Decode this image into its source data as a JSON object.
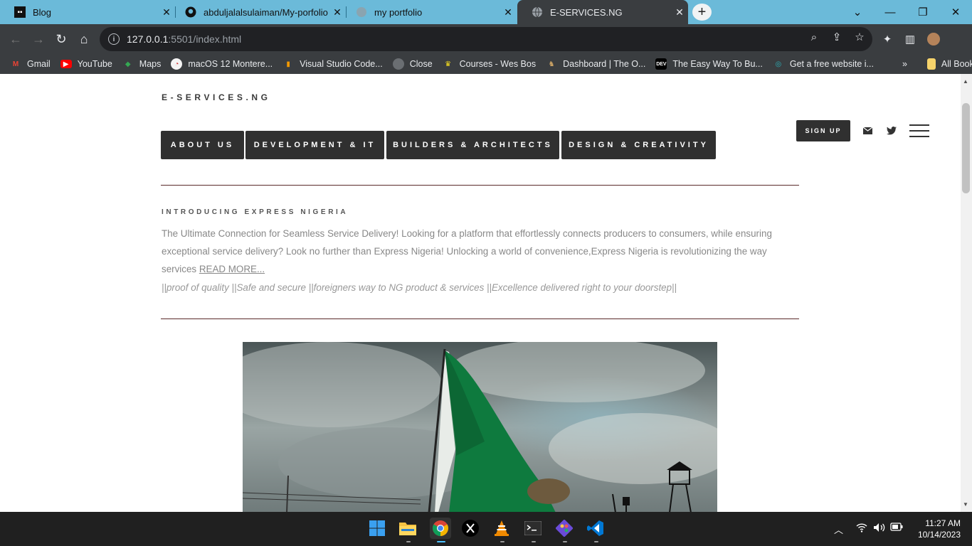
{
  "browser": {
    "tabs": [
      {
        "title": "Blog",
        "icon": "blog-favicon",
        "active": false
      },
      {
        "title": "abduljalalsulaiman/My-porfolio",
        "icon": "github-icon",
        "active": false
      },
      {
        "title": "my portfolio",
        "icon": "globe-icon",
        "active": false
      },
      {
        "title": "E-SERVICES.NG",
        "icon": "globe-icon",
        "active": true
      }
    ],
    "url_host": "127.0.0.1",
    "url_rest": ":5501/index.html",
    "bookmarks": [
      {
        "label": "Gmail",
        "icon": "gmail-icon",
        "color": "#ea4335"
      },
      {
        "label": "YouTube",
        "icon": "youtube-icon",
        "color": "#ff0000"
      },
      {
        "label": "Maps",
        "icon": "maps-icon",
        "color": "#34a853"
      },
      {
        "label": "macOS 12 Montere...",
        "icon": "bookmark-site-icon",
        "color": "#e8eaed"
      },
      {
        "label": "Visual Studio Code...",
        "icon": "bookmark-flag-icon",
        "color": "#f29900"
      },
      {
        "label": "Close",
        "icon": "globe-icon",
        "color": "#9aa0a6"
      },
      {
        "label": "Courses - Wes Bos",
        "icon": "crown-icon",
        "color": "#f7df1e"
      },
      {
        "label": "Dashboard | The O...",
        "icon": "odin-icon",
        "color": "#c8a063"
      },
      {
        "label": "The Easy Way To Bu...",
        "icon": "dev-icon",
        "color": "#000000"
      },
      {
        "label": "Get a free website i...",
        "icon": "website-builder-icon",
        "color": "#2bb0b8"
      }
    ],
    "all_bookmarks": "All Bookmarks"
  },
  "site": {
    "brand": "E-SERVICES.NG",
    "menu": [
      "ABOUT US",
      "DEVELOPMENT & IT",
      "BUILDERS & ARCHITECTS",
      "DESIGN & CREATIVITY"
    ],
    "signup": "SIGN UP",
    "intro_heading": "INTRODUCING EXPRESS NIGERIA",
    "intro_text": "The Ultimate Connection for Seamless Service Delivery! Looking for a platform that effortlessly connects producers to consumers, while ensuring exceptional service delivery? Look no further than Express Nigeria! Unlocking a world of convenience,Express Nigeria is revolutionizing the way services ",
    "read_more": "READ MORE...",
    "tagline": "||proof of quality ||Safe and secure ||foreigners way to NG product & services ||Excellence delivered right to your doorstep||"
  },
  "taskbar": {
    "time": "11:27 AM",
    "date": "10/14/2023"
  },
  "colors": {
    "tabbar": "#6bbad9",
    "chrome_dark": "#3a3d40",
    "menu_button": "#303030",
    "flag_green": "#0e7a3e"
  }
}
